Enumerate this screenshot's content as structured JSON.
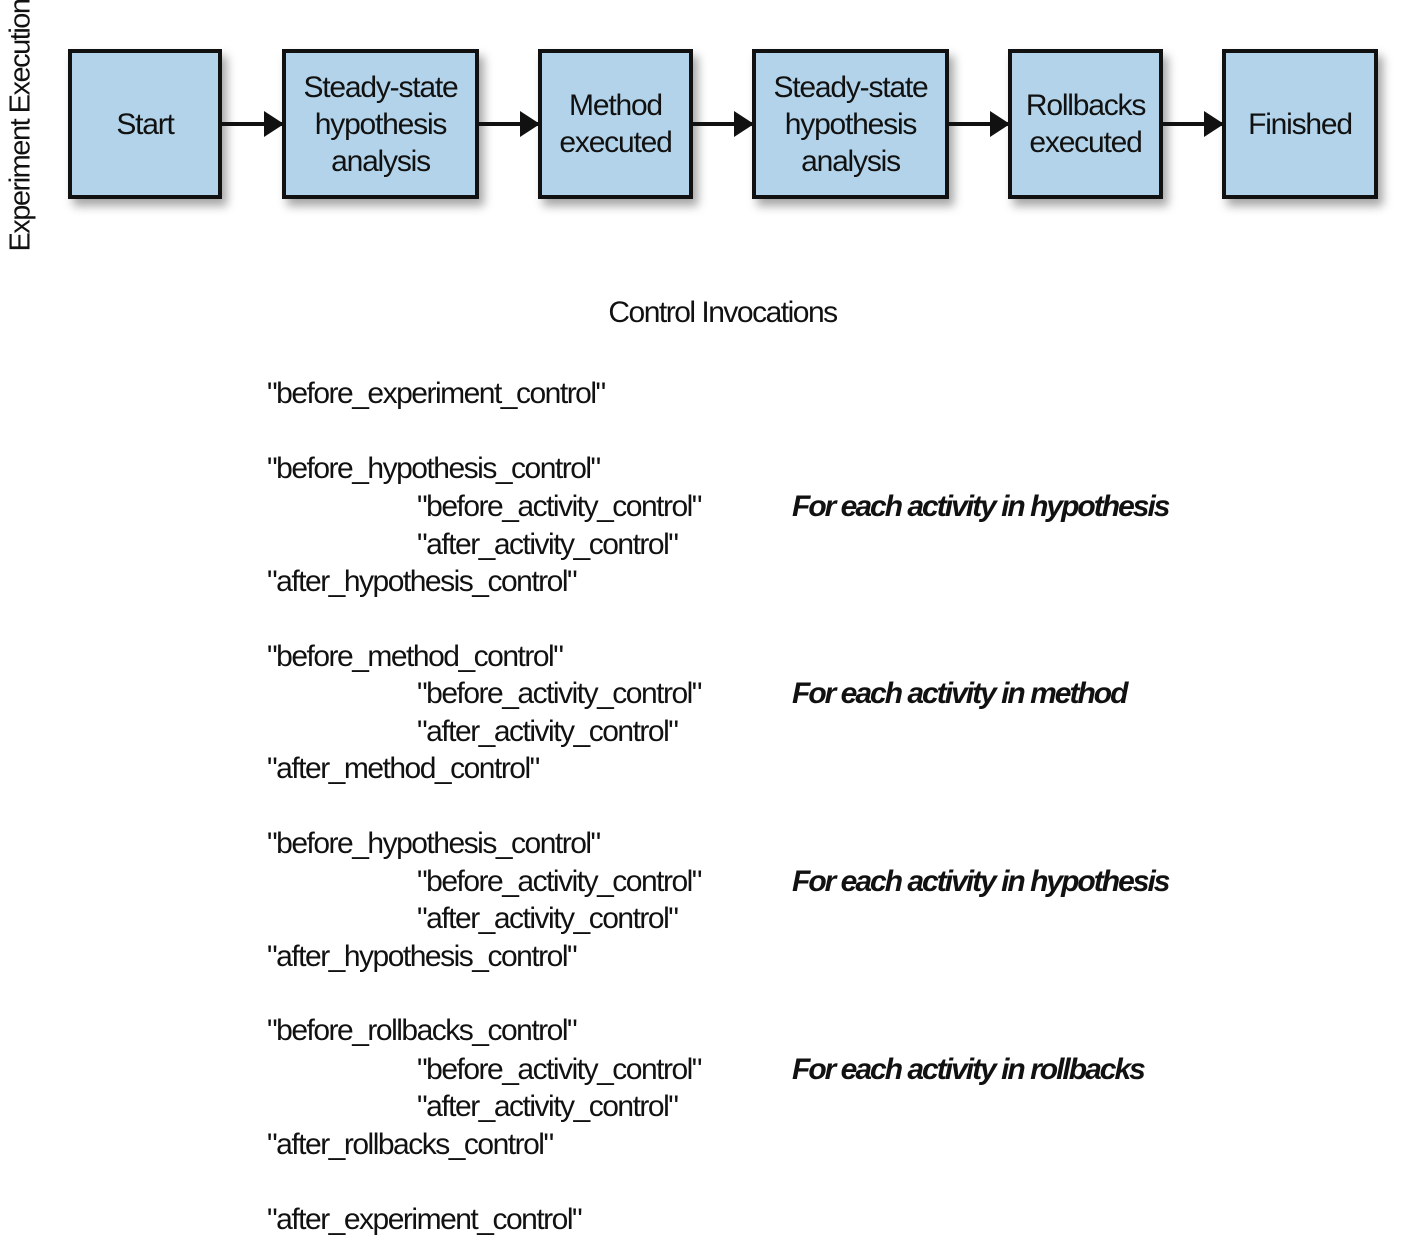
{
  "side_label": "Experiment Execution",
  "flow": {
    "steps": [
      {
        "label": "Start"
      },
      {
        "label": "Steady-state\nhypothesis\nanalysis"
      },
      {
        "label": "Method\nexecuted"
      },
      {
        "label": "Steady-state\nhypothesis\nanalysis"
      },
      {
        "label": "Rollbacks\nexecuted"
      },
      {
        "label": "Finished"
      }
    ],
    "box_fill_color": "#b2d3e9",
    "box_border_color": "#111111"
  },
  "control_invocations": {
    "title": "Control Invocations",
    "lines": [
      {
        "text": "\"before_experiment_control\"",
        "level": 0
      },
      {
        "text": "\"before_hypothesis_control\"",
        "level": 0
      },
      {
        "text": "\"before_activity_control\"",
        "level": 1,
        "note": "For each activity in hypothesis"
      },
      {
        "text": "\"after_activity_control\"",
        "level": 1
      },
      {
        "text": "\"after_hypothesis_control\"",
        "level": 0
      },
      {
        "text": "\"before_method_control\"",
        "level": 0
      },
      {
        "text": "\"before_activity_control\"",
        "level": 1,
        "note": "For each activity in method"
      },
      {
        "text": "\"after_activity_control\"",
        "level": 1
      },
      {
        "text": "\"after_method_control\"",
        "level": 0
      },
      {
        "text": "\"before_hypothesis_control\"",
        "level": 0
      },
      {
        "text": "\"before_activity_control\"",
        "level": 1,
        "note": "For each activity in hypothesis"
      },
      {
        "text": "\"after_activity_control\"",
        "level": 1
      },
      {
        "text": "\"after_hypothesis_control\"",
        "level": 0
      },
      {
        "text": "\"before_rollbacks_control\"",
        "level": 0
      },
      {
        "text": "\"before_activity_control\"",
        "level": 1,
        "note": "For each activity in rollbacks"
      },
      {
        "text": "\"after_activity_control\"",
        "level": 1
      },
      {
        "text": "\"after_rollbacks_control\"",
        "level": 0
      },
      {
        "text": "\"after_experiment_control\"",
        "level": 0
      }
    ]
  }
}
